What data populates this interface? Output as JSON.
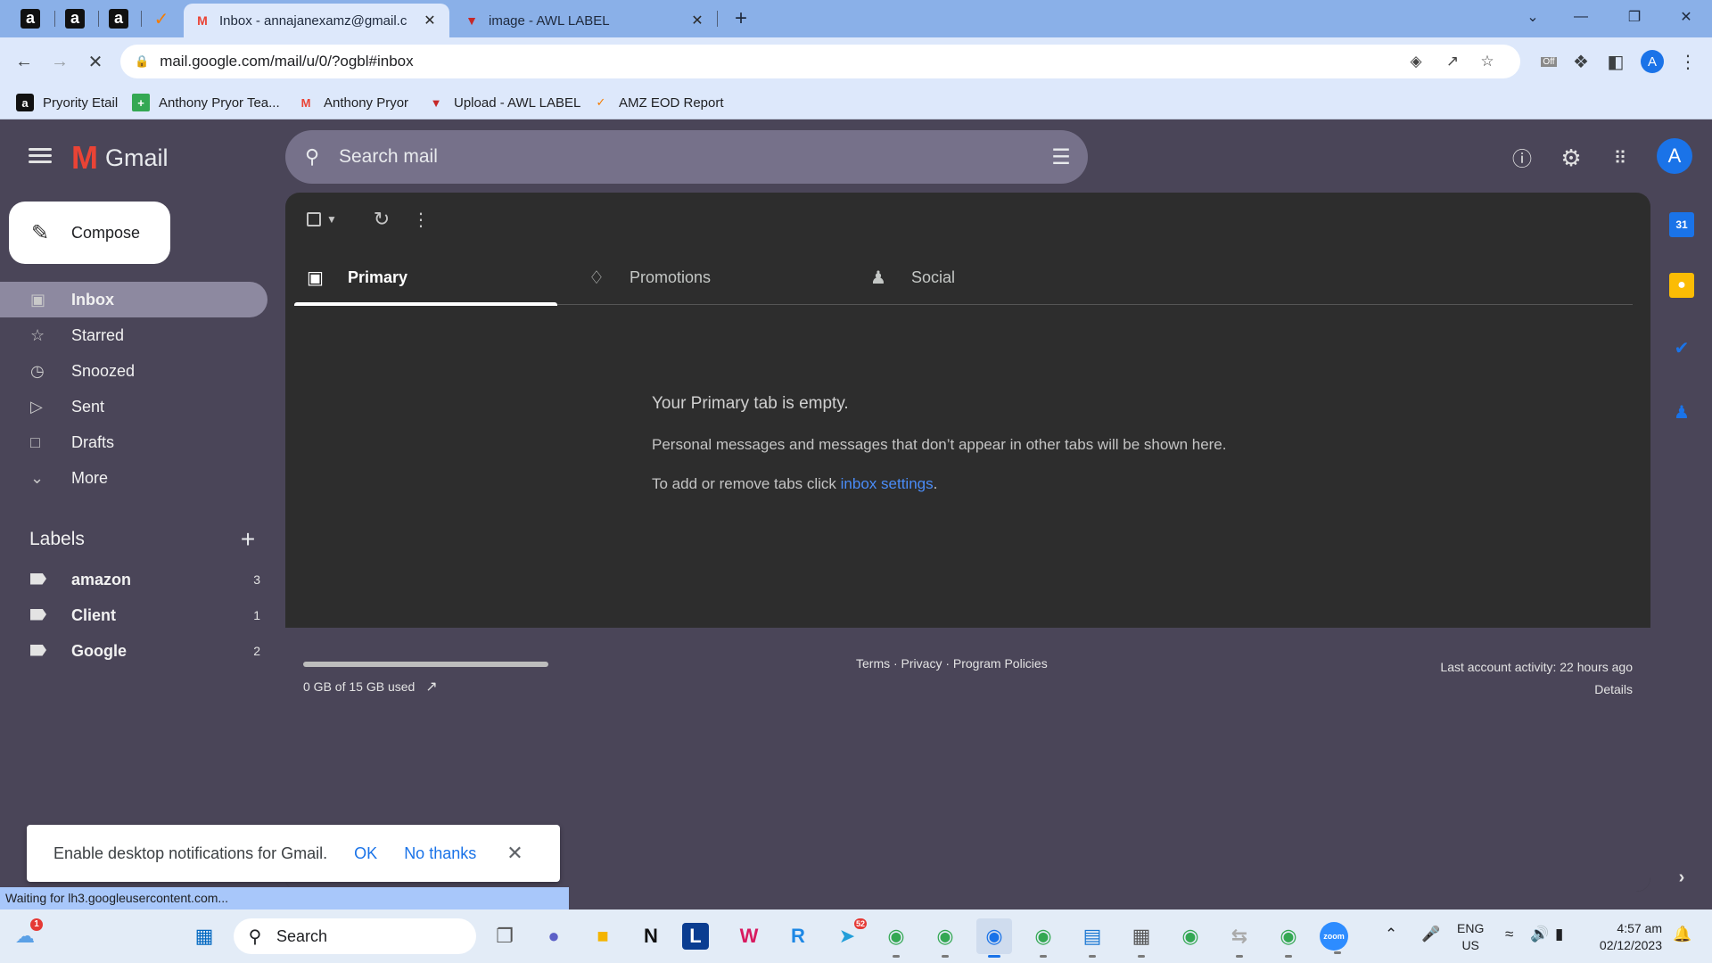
{
  "browser": {
    "tabs": [
      {
        "title": "Inbox - annajanexamz@gmail.c",
        "favicon": "gmail-icon",
        "active": true
      },
      {
        "title": "image - AWL LABEL",
        "favicon": "awl-icon",
        "active": false
      }
    ],
    "new_tab": "+",
    "url": "mail.google.com/mail/u/0/?ogbl#inbox",
    "profile_initial": "A",
    "bookmarks": [
      {
        "label": "Pryority Etail",
        "icon": "amazon-icon"
      },
      {
        "label": "Anthony Pryor Tea...",
        "icon": "plus-box-icon"
      },
      {
        "label": "Anthony Pryor",
        "icon": "gmail-icon"
      },
      {
        "label": "Upload - AWL LABEL",
        "icon": "awl-icon"
      },
      {
        "label": "AMZ EOD Report",
        "icon": "tasks-icon"
      }
    ],
    "extension_badge": "Off",
    "status_text": "Waiting for lh3.googleusercontent.com..."
  },
  "gmail": {
    "logo_text": "Gmail",
    "search_placeholder": "Search mail",
    "account_initial": "A",
    "compose_label": "Compose",
    "nav": [
      {
        "label": "Inbox",
        "icon": "inbox-icon",
        "selected": true
      },
      {
        "label": "Starred",
        "icon": "star-icon"
      },
      {
        "label": "Snoozed",
        "icon": "clock-icon"
      },
      {
        "label": "Sent",
        "icon": "send-icon"
      },
      {
        "label": "Drafts",
        "icon": "draft-icon"
      },
      {
        "label": "More",
        "icon": "chevron-down-icon"
      }
    ],
    "labels_heading": "Labels",
    "labels": [
      {
        "name": "amazon",
        "count": "3"
      },
      {
        "name": "Client",
        "count": "1"
      },
      {
        "name": "Google",
        "count": "2"
      }
    ],
    "tabs": [
      {
        "label": "Primary",
        "icon": "inbox-tab-icon",
        "active": true
      },
      {
        "label": "Promotions",
        "icon": "tag-icon"
      },
      {
        "label": "Social",
        "icon": "people-icon"
      }
    ],
    "empty": {
      "heading": "Your Primary tab is empty.",
      "body": "Personal messages and messages that don’t appear in other tabs will be shown here.",
      "settings_prefix": "To add or remove tabs click ",
      "settings_link": "inbox settings",
      "settings_suffix": "."
    },
    "footer": {
      "storage": "0 GB of 15 GB used",
      "storage_fraction": 0.0,
      "policies": "Terms · Privacy · Program Policies",
      "activity": "Last account activity: 22 hours ago",
      "details": "Details"
    },
    "notification": {
      "text": "Enable desktop notifications for Gmail.",
      "ok": "OK",
      "no": "No thanks"
    }
  },
  "taskbar": {
    "search_label": "Search",
    "lang": "ENG",
    "region": "US",
    "time": "4:57 am",
    "date": "02/12/2023",
    "weather_badge": "1",
    "telegram_badge": "52"
  },
  "colors": {
    "gmail_bg": "#4a4558",
    "panel_bg": "#2d2d2d",
    "accent_blue": "#1a73e8",
    "chrome_tabstrip": "#8ab0e8"
  }
}
